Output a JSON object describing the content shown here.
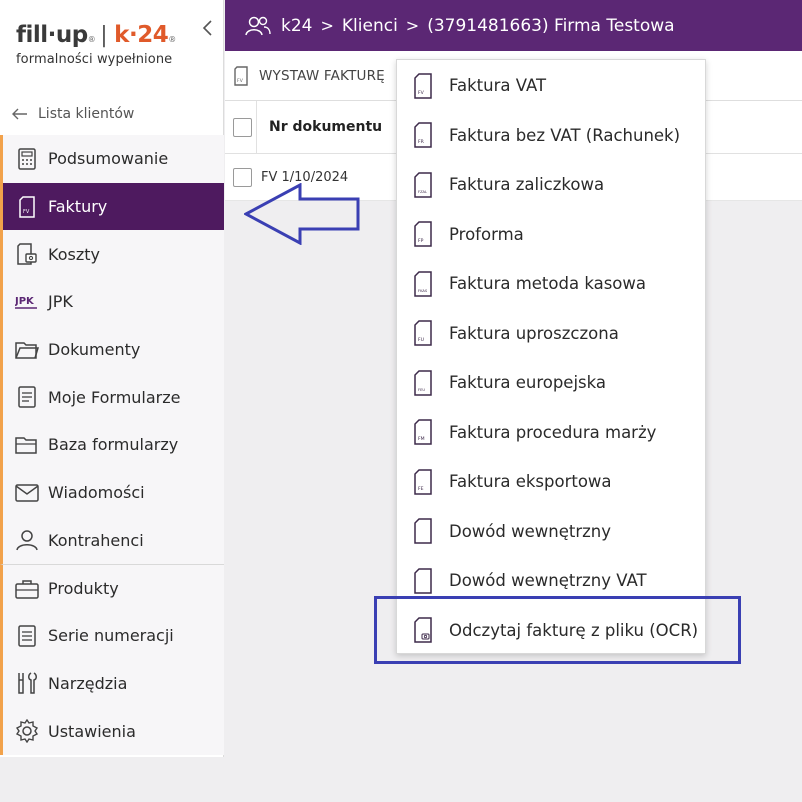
{
  "logo": {
    "brand_fill": "fill·up",
    "brand_reg": "®",
    "separator": "|",
    "brand_k": "k·24",
    "tagline": "formalności wypełnione"
  },
  "sidebar": {
    "back_label": "Lista klientów",
    "items": [
      {
        "label": "Podsumowanie",
        "icon": "calculator-icon"
      },
      {
        "label": "Faktury",
        "icon": "invoice-icon",
        "active": true
      },
      {
        "label": "Koszty",
        "icon": "costs-icon"
      },
      {
        "label": "JPK",
        "icon": "jpk-icon"
      },
      {
        "label": "Dokumenty",
        "icon": "folder-icon"
      },
      {
        "label": "Moje Formularze",
        "icon": "form-icon"
      },
      {
        "label": "Baza formularzy",
        "icon": "folder-stack-icon"
      },
      {
        "label": "Wiadomości",
        "icon": "envelope-icon"
      },
      {
        "label": "Kontrahenci",
        "icon": "person-icon"
      },
      {
        "label": "Produkty",
        "icon": "briefcase-icon"
      },
      {
        "label": "Serie numeracji",
        "icon": "document-lines-icon"
      },
      {
        "label": "Narzędzia",
        "icon": "tools-icon"
      },
      {
        "label": "Ustawienia",
        "icon": "gear-icon"
      }
    ]
  },
  "topbar": {
    "crumb1": "k24",
    "sep": ">",
    "crumb2": "Klienci",
    "crumb3": "(3791481663) Firma Testowa"
  },
  "toolbar": {
    "issue_label": "WYSTAW FAKTURĘ"
  },
  "table": {
    "header_doc": "Nr dokumentu",
    "row1_doc": "FV 1/10/2024"
  },
  "dropdown": {
    "items": [
      {
        "label": "Faktura VAT",
        "code": "FV"
      },
      {
        "label": "Faktura bez VAT (Rachunek)",
        "code": "FR"
      },
      {
        "label": "Faktura zaliczkowa",
        "code": "FZAL"
      },
      {
        "label": "Proforma",
        "code": "FP"
      },
      {
        "label": "Faktura metoda kasowa",
        "code": "FKAS"
      },
      {
        "label": "Faktura uproszczona",
        "code": "FU"
      },
      {
        "label": "Faktura europejska",
        "code": "FEU"
      },
      {
        "label": "Faktura procedura marży",
        "code": "FM"
      },
      {
        "label": "Faktura eksportowa",
        "code": "FE"
      },
      {
        "label": "Dowód wewnętrzny",
        "code": ""
      },
      {
        "label": "Dowód wewnętrzny VAT",
        "code": ""
      },
      {
        "label": "Odczytaj fakturę z pliku (OCR)",
        "code": "OCR"
      }
    ]
  },
  "colors": {
    "brand_purple": "#5b2774",
    "active_purple": "#4e1a5f",
    "accent_orange": "#f2a24b",
    "annotation_blue": "#3a3fb3"
  }
}
